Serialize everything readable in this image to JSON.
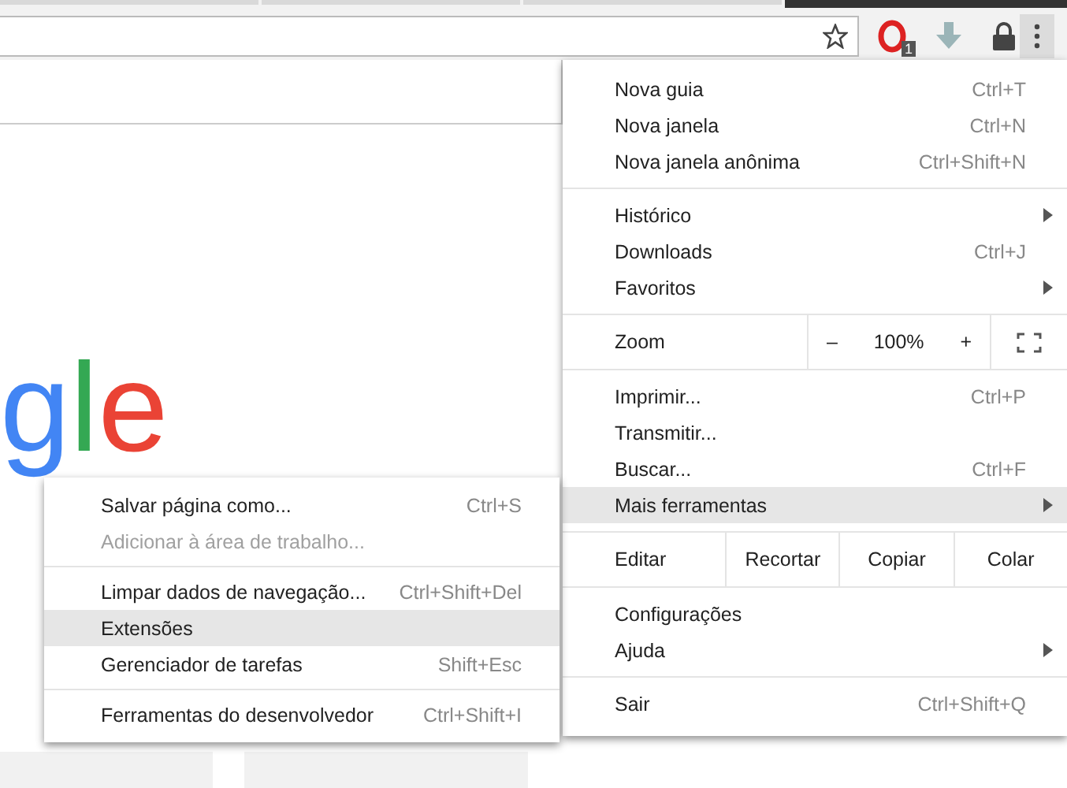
{
  "toolbar": {
    "extension_badge": "1"
  },
  "page": {
    "logo": [
      {
        "char": "g",
        "color": "#4285f4"
      },
      {
        "char": "l",
        "color": "#34a853"
      },
      {
        "char": "e",
        "color": "#ea4335"
      }
    ]
  },
  "menu": {
    "sections": [
      {
        "items": [
          {
            "kind": "item",
            "label": "Nova guia",
            "shortcut": "Ctrl+T",
            "submenu": false,
            "selected": false
          },
          {
            "kind": "item",
            "label": "Nova janela",
            "shortcut": "Ctrl+N",
            "submenu": false,
            "selected": false
          },
          {
            "kind": "item",
            "label": "Nova janela anônima",
            "shortcut": "Ctrl+Shift+N",
            "submenu": false,
            "selected": false
          }
        ]
      },
      {
        "items": [
          {
            "kind": "item",
            "label": "Histórico",
            "submenu": true,
            "selected": false
          },
          {
            "kind": "item",
            "label": "Downloads",
            "shortcut": "Ctrl+J",
            "submenu": false,
            "selected": false
          },
          {
            "kind": "item",
            "label": "Favoritos",
            "submenu": true,
            "selected": false
          }
        ]
      },
      {
        "items": [
          {
            "kind": "zoom",
            "label": "Zoom",
            "minus": "–",
            "value": "100%",
            "plus": "+"
          }
        ]
      },
      {
        "items": [
          {
            "kind": "item",
            "label": "Imprimir...",
            "shortcut": "Ctrl+P",
            "submenu": false,
            "selected": false
          },
          {
            "kind": "item",
            "label": "Transmitir...",
            "submenu": false,
            "selected": false
          },
          {
            "kind": "item",
            "label": "Buscar...",
            "shortcut": "Ctrl+F",
            "submenu": false,
            "selected": false
          },
          {
            "kind": "item",
            "label": "Mais ferramentas",
            "submenu": true,
            "selected": true
          }
        ]
      },
      {
        "items": [
          {
            "kind": "edit",
            "label": "Editar",
            "buttons": [
              "Recortar",
              "Copiar",
              "Colar"
            ]
          }
        ]
      },
      {
        "items": [
          {
            "kind": "item",
            "label": "Configurações",
            "submenu": false,
            "selected": false
          },
          {
            "kind": "item",
            "label": "Ajuda",
            "submenu": true,
            "selected": false
          }
        ]
      },
      {
        "items": [
          {
            "kind": "item",
            "label": "Sair",
            "shortcut": "Ctrl+Shift+Q",
            "submenu": false,
            "selected": false
          }
        ]
      }
    ]
  },
  "submenu": {
    "sections": [
      {
        "items": [
          {
            "label": "Salvar página como...",
            "shortcut": "Ctrl+S",
            "disabled": false,
            "selected": false
          },
          {
            "label": "Adicionar à área de trabalho...",
            "disabled": true,
            "selected": false
          }
        ]
      },
      {
        "items": [
          {
            "label": "Limpar dados de navegação...",
            "shortcut": "Ctrl+Shift+Del",
            "disabled": false,
            "selected": false
          },
          {
            "label": "Extensões",
            "disabled": false,
            "selected": true
          },
          {
            "label": "Gerenciador de tarefas",
            "shortcut": "Shift+Esc",
            "disabled": false,
            "selected": false
          }
        ]
      },
      {
        "items": [
          {
            "label": "Ferramentas do desenvolvedor",
            "shortcut": "Ctrl+Shift+I",
            "disabled": false,
            "selected": false
          }
        ]
      }
    ]
  }
}
